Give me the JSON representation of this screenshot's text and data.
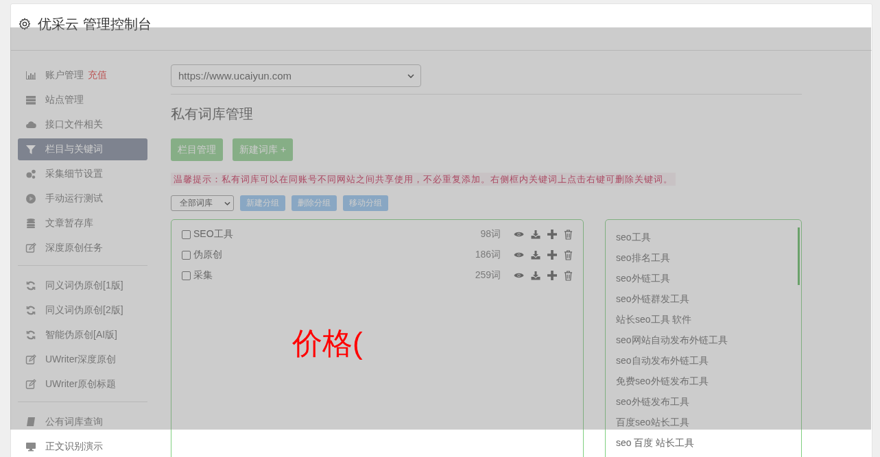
{
  "header": {
    "title": "优采云 管理控制台"
  },
  "sidebar": {
    "groups": [
      {
        "items": [
          {
            "label": "账户管理",
            "badge": "充值",
            "selected": false
          },
          {
            "label": "站点管理",
            "selected": false
          },
          {
            "label": "接口文件相关",
            "selected": false
          },
          {
            "label": "栏目与关键词",
            "selected": true
          },
          {
            "label": "采集细节设置",
            "selected": false
          },
          {
            "label": "手动运行测试",
            "selected": false
          },
          {
            "label": "文章暂存库",
            "selected": false
          },
          {
            "label": "深度原创任务",
            "selected": false
          }
        ]
      },
      {
        "items": [
          {
            "label": "同义词伪原创[1版]",
            "selected": false
          },
          {
            "label": "同义词伪原创[2版]",
            "selected": false
          },
          {
            "label": "智能伪原创[AI版]",
            "selected": false
          },
          {
            "label": "UWriter深度原创",
            "selected": false
          },
          {
            "label": "UWriter原创标题",
            "selected": false
          }
        ]
      },
      {
        "items": [
          {
            "label": "公有词库查询",
            "selected": false
          },
          {
            "label": "正文识别演示",
            "selected": false
          }
        ]
      }
    ]
  },
  "site_select": {
    "value": "https://www.ucaiyun.com"
  },
  "page_title": "私有词库管理",
  "actions": [
    "栏目管理",
    "新建词库 +"
  ],
  "tip": "温馨提示：私有词库可以在同账号不同网站之间共享使用，不必重复添加。右侧框内关键词上点击右键可删除关键词。",
  "group_filter": {
    "value": "全部词库"
  },
  "group_buttons": [
    "新建分组",
    "删除分组",
    "移动分组"
  ],
  "libraries": [
    {
      "name": "SEO工具",
      "checked": false,
      "count": "98词"
    },
    {
      "name": "伪原创",
      "checked": false,
      "count": "186词"
    },
    {
      "name": "采集",
      "checked": false,
      "count": "259词"
    }
  ],
  "keywords": [
    "seo工具",
    "seo排名工具",
    "seo外链工具",
    "seo外链群发工具",
    "站长seo工具 软件",
    "seo网站自动发布外链工具",
    "seo自动发布外链工具",
    "免费seo外链发布工具",
    "seo外链发布工具",
    "百度seo站长工具",
    "seo 百度 站长工具"
  ],
  "overlay": {
    "text": "价格("
  }
}
